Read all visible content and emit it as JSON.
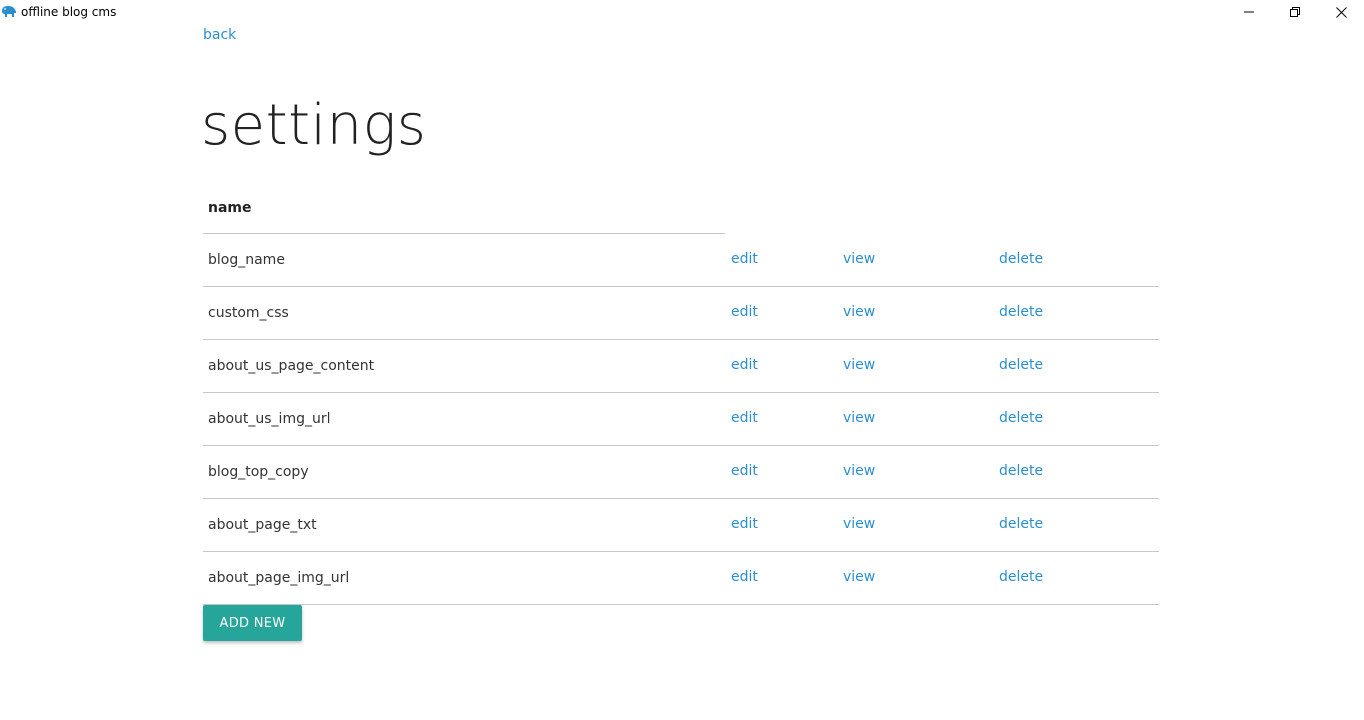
{
  "window": {
    "title": "offline blog cms",
    "controls": [
      "minimize-icon",
      "restore-icon",
      "close-icon"
    ]
  },
  "nav": {
    "back_label": "back"
  },
  "page": {
    "title": "settings"
  },
  "table": {
    "header": "name",
    "rows": [
      {
        "name": "blog_name",
        "edit": "edit",
        "view": "view",
        "delete": "delete"
      },
      {
        "name": "custom_css",
        "edit": "edit",
        "view": "view",
        "delete": "delete"
      },
      {
        "name": "about_us_page_content",
        "edit": "edit",
        "view": "view",
        "delete": "delete"
      },
      {
        "name": "about_us_img_url",
        "edit": "edit",
        "view": "view",
        "delete": "delete"
      },
      {
        "name": "blog_top_copy",
        "edit": "edit",
        "view": "view",
        "delete": "delete"
      },
      {
        "name": "about_page_txt",
        "edit": "edit",
        "view": "view",
        "delete": "delete"
      },
      {
        "name": "about_page_img_url",
        "edit": "edit",
        "view": "view",
        "delete": "delete"
      }
    ]
  },
  "actions": {
    "add_new_label": "ADD NEW"
  },
  "colors": {
    "link": "#2a8fcf",
    "button": "#26a69a",
    "divider": "#c8c8c8"
  }
}
